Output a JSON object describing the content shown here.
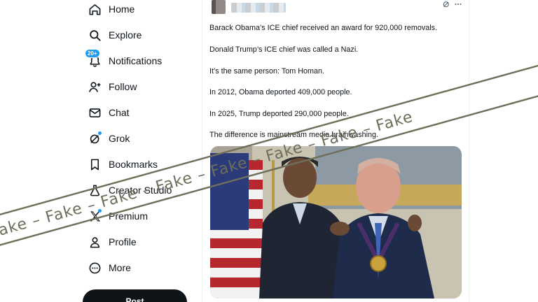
{
  "nav": {
    "items": [
      {
        "label": "Home",
        "icon": "home-icon"
      },
      {
        "label": "Explore",
        "icon": "search-icon"
      },
      {
        "label": "Notifications",
        "icon": "bell-icon",
        "badge": "20+"
      },
      {
        "label": "Follow",
        "icon": "follow-icon"
      },
      {
        "label": "Chat",
        "icon": "mail-icon"
      },
      {
        "label": "Grok",
        "icon": "grok-icon"
      },
      {
        "label": "Bookmarks",
        "icon": "bookmark-icon"
      },
      {
        "label": "Creator Studio",
        "icon": "creator-studio-icon"
      },
      {
        "label": "Premium",
        "icon": "x-logo-icon"
      },
      {
        "label": "Profile",
        "icon": "profile-icon"
      },
      {
        "label": "More",
        "icon": "more-circle-icon"
      }
    ],
    "post_label": "Post"
  },
  "tweet": {
    "lines": [
      "Barack Obama’s ICE chief received an award for 920,000 removals.",
      "Donald Trump’s ICE chief was called a Nazi.",
      "It’s the same person: Tom Homan.",
      "In 2012, Obama deported 409,000 people.",
      "In 2025, Trump deported 290,000 people.",
      "The difference is mainstream media brainwashing."
    ]
  },
  "watermark": {
    "text": "Fake – Fake – Fake – Fake – Fake – Fake – Fake – Fake",
    "color": "#6e6e5a"
  },
  "colors": {
    "accent": "#1d9bf0",
    "text": "#0f1419"
  }
}
